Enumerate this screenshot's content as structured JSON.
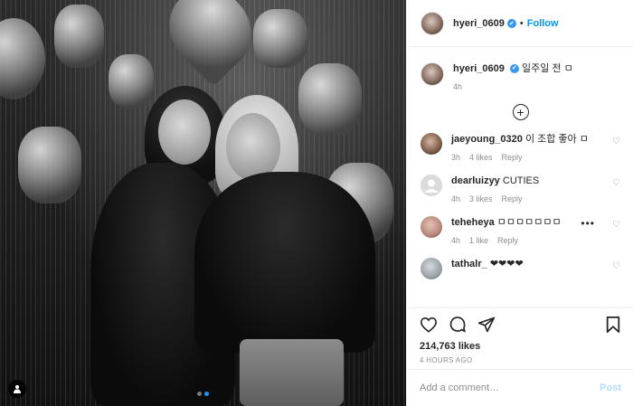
{
  "post": {
    "username": "hyeri_0609",
    "follow_label": "Follow",
    "separator": "•",
    "verified_mark": "✔",
    "caption": "일주일 전 ㅁ",
    "caption_age": "4h",
    "likes": "214,763 likes",
    "posted": "4 HOURS AGO",
    "carousel_total": 2,
    "carousel_active": 2
  },
  "comments": [
    {
      "user": "jaeyoung_0320",
      "text": "이 조합 좋아 ㅁ",
      "age": "3h",
      "likes": "4 likes",
      "reply": "Reply",
      "avatar_color": "#7a5a48"
    },
    {
      "user": "dearluizyy",
      "text": "CUTIES",
      "age": "4h",
      "likes": "3 likes",
      "reply": "Reply",
      "avatar_color": "#dbdbdb"
    },
    {
      "user": "teheheya",
      "text": "ㅁㅁㅁㅁㅁㅁㅁ",
      "age": "4h",
      "likes": "1 like",
      "reply": "Reply",
      "avatar_color": "#b9867a"
    },
    {
      "user": "tathalr_",
      "text": "❤❤❤❤",
      "avatar_color": "#9aa3a8"
    }
  ],
  "comment_input": {
    "placeholder": "Add a comment…",
    "post_label": "Post"
  },
  "icons": {
    "header": "verified-badge-icon",
    "load_more": "plus-circle-icon",
    "like": "heart-icon",
    "comment": "comment-bubble-icon",
    "share": "paper-plane-icon",
    "save": "bookmark-icon",
    "tag": "user-tag-icon"
  },
  "colors": {
    "accent": "#0095f6",
    "verified": "#3897f0",
    "muted": "#8e8e8e",
    "post_disabled": "#b3dbff"
  }
}
